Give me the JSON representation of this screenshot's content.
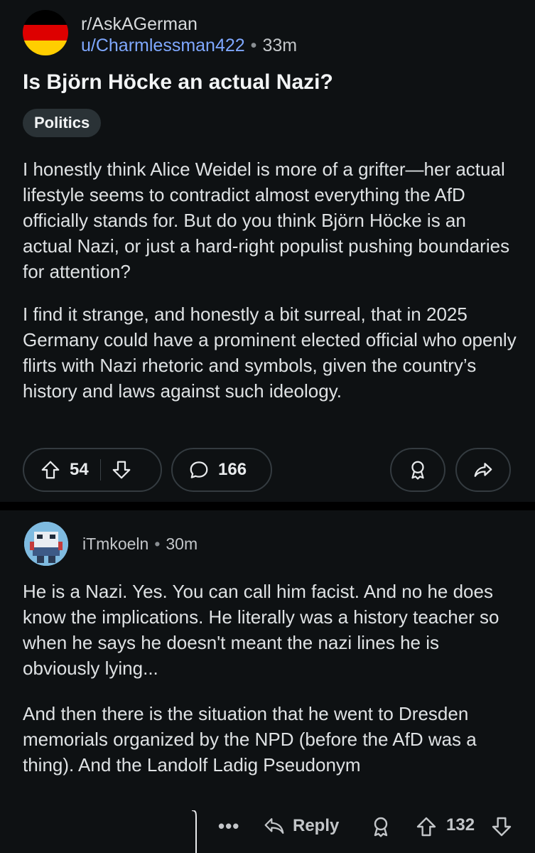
{
  "post": {
    "subreddit": "r/AskAGerman",
    "author": "u/Charmlessman422",
    "separator": "•",
    "time": "33m",
    "title": "Is Björn Höcke an actual Nazi?",
    "flair": "Politics",
    "body_p1": "I honestly think Alice Weidel is more of a grifter—her actual lifestyle seems to contradict almost everything the AfD officially stands for. But do you think Björn Höcke is an actual Nazi, or just a hard-right populist pushing boundaries for attention?",
    "body_p2": "I find it strange, and honestly a bit surreal, that in 2025 Germany could have a prominent elected official who openly flirts with Nazi rhetoric and symbols, given the country’s history and laws against such ideology.",
    "upvotes": "54",
    "comments": "166",
    "flag_colors": [
      "#000000",
      "#dd0000",
      "#ffce00"
    ]
  },
  "comment": {
    "user": "iTmkoeln",
    "separator": "•",
    "time": "30m",
    "text_p1": "He is a Nazi. Yes. You can call him facist. And no he does know the implications. He literally was a history teacher so when he says he doesn't meant the nazi lines he is obviously lying...",
    "text_p2": "And then there is the situation that he went to Dresden memorials organized by the NPD (before the AfD was a thing). And the Landolf Ladig Pseudonym",
    "more": "•••",
    "reply_label": "Reply",
    "score": "132"
  },
  "icons": {
    "upvote": "arrow-up-outline-icon",
    "downvote": "arrow-down-outline-icon",
    "comment": "speech-bubble-icon",
    "award": "award-ribbon-icon",
    "share": "share-arrow-icon",
    "reply": "reply-arrow-icon"
  },
  "colors": {
    "background": "#0e1113",
    "author_link": "#7fa8ff",
    "flair_bg": "#2a3236",
    "pill_border": "#343b40"
  }
}
